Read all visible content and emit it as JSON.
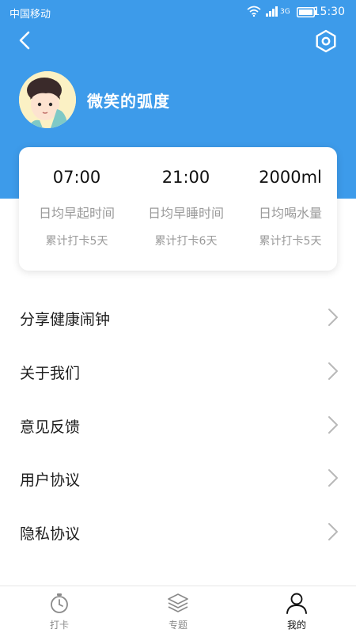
{
  "status_bar": {
    "carrier": "中国移动",
    "network": "3G",
    "time": "15:30"
  },
  "header": {
    "back_icon": "chevron-left-icon",
    "settings_icon": "hexagon-settings-icon"
  },
  "profile": {
    "username": "微笑的弧度"
  },
  "stats": [
    {
      "value": "07:00",
      "label": "日均早起时间",
      "days": "累计打卡5天"
    },
    {
      "value": "21:00",
      "label": "日均早睡时间",
      "days": "累计打卡6天"
    },
    {
      "value": "2000ml",
      "label": "日均喝水量",
      "days": "累计打卡5天"
    }
  ],
  "menu": [
    {
      "label": "分享健康闹钟"
    },
    {
      "label": "关于我们"
    },
    {
      "label": "意见反馈"
    },
    {
      "label": "用户协议"
    },
    {
      "label": "隐私协议"
    }
  ],
  "tabbar": [
    {
      "label": "打卡",
      "icon": "stopwatch-icon",
      "active": false
    },
    {
      "label": "专题",
      "icon": "layers-icon",
      "active": false
    },
    {
      "label": "我的",
      "icon": "user-icon",
      "active": true
    }
  ],
  "colors": {
    "header_blue": "#3d9bea",
    "card_bg": "#ffffff",
    "muted_text": "#9a9a9a"
  }
}
